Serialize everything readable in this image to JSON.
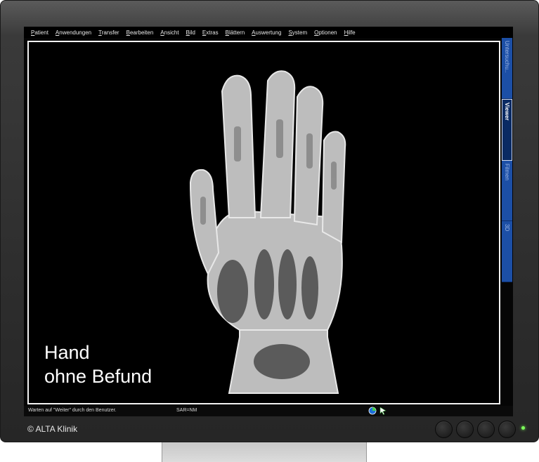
{
  "menubar": {
    "items": [
      "Patient",
      "Anwendungen",
      "Transfer",
      "Bearbeiten",
      "Ansicht",
      "Bild",
      "Extras",
      "Blättern",
      "Auswertung",
      "System",
      "Optionen",
      "Hilfe"
    ]
  },
  "side_tabs": [
    {
      "label": "Untersuchu..",
      "active": false
    },
    {
      "label": "Viewer",
      "active": true
    },
    {
      "label": "Filmen",
      "active": false
    },
    {
      "label": "3D",
      "active": false
    }
  ],
  "caption": {
    "line1": "Hand",
    "line2": "ohne Befund"
  },
  "status_bar": {
    "message": "Warten auf \"Weiter\" durch den Benutzer.",
    "mode": "SAR=NM"
  },
  "copyright": "© ALTA Klinik",
  "colors": {
    "tab_blue": "#1c4fa6",
    "tab_active": "#0a2a63",
    "led": "#7dff5a"
  }
}
